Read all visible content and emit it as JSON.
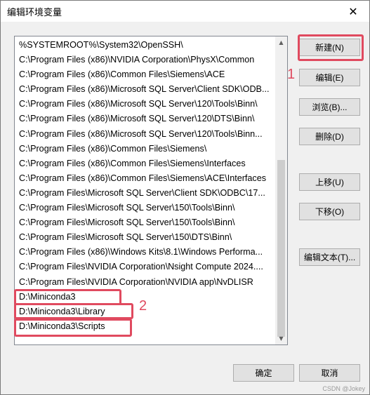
{
  "window": {
    "title": "编辑环境变量",
    "close_label": "✕"
  },
  "path_list": [
    "%SYSTEMROOT%\\System32\\OpenSSH\\",
    "C:\\Program Files (x86)\\NVIDIA Corporation\\PhysX\\Common",
    "C:\\Program Files (x86)\\Common Files\\Siemens\\ACE",
    "C:\\Program Files (x86)\\Microsoft SQL Server\\Client SDK\\ODB...",
    "C:\\Program Files (x86)\\Microsoft SQL Server\\120\\Tools\\Binn\\",
    "C:\\Program Files (x86)\\Microsoft SQL Server\\120\\DTS\\Binn\\",
    "C:\\Program Files (x86)\\Microsoft SQL Server\\120\\Tools\\Binn...",
    "C:\\Program Files (x86)\\Common Files\\Siemens\\",
    "C:\\Program Files (x86)\\Common Files\\Siemens\\Interfaces",
    "C:\\Program Files (x86)\\Common Files\\Siemens\\ACE\\Interfaces",
    "C:\\Program Files\\Microsoft SQL Server\\Client SDK\\ODBC\\17...",
    "C:\\Program Files\\Microsoft SQL Server\\150\\Tools\\Binn\\",
    "C:\\Program Files\\Microsoft SQL Server\\150\\Tools\\Binn\\",
    "C:\\Program Files\\Microsoft SQL Server\\150\\DTS\\Binn\\",
    "C:\\Program Files (x86)\\Windows Kits\\8.1\\Windows Performa...",
    "C:\\Program Files\\NVIDIA Corporation\\Nsight Compute 2024....",
    "C:\\Program Files\\NVIDIA Corporation\\NVIDIA app\\NvDLISR",
    "D:\\Miniconda3",
    "D:\\Miniconda3\\Library",
    "D:\\Miniconda3\\Scripts"
  ],
  "buttons": {
    "new": "新建(N)",
    "edit": "编辑(E)",
    "browse": "浏览(B)...",
    "delete": "删除(D)",
    "move_up": "上移(U)",
    "move_down": "下移(O)",
    "edit_text": "编辑文本(T)...",
    "ok": "确定",
    "cancel": "取消"
  },
  "annotations": {
    "marker_1": "1",
    "marker_2": "2"
  },
  "watermark": "CSDN @Jokey",
  "colors": {
    "highlight": "#e04a5f"
  }
}
